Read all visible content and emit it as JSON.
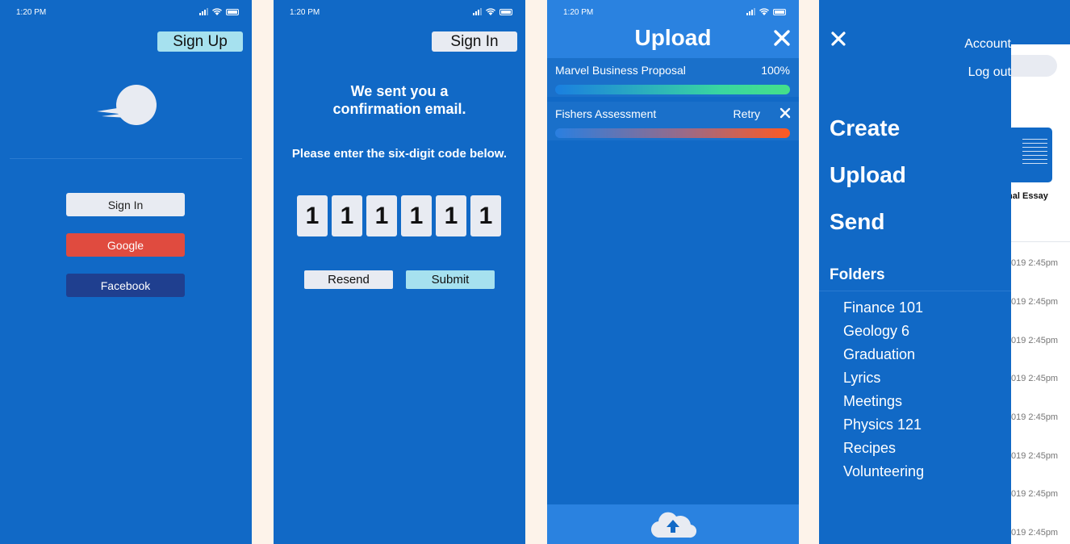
{
  "screen1": {
    "time": "1:20 PM",
    "signup_label": "Sign Up",
    "signin_label": "Sign In",
    "google_label": "Google",
    "facebook_label": "Facebook"
  },
  "screen2": {
    "time": "1:20 PM",
    "signin_label": "Sign In",
    "title_line1": "We sent you a",
    "title_line2": "confirmation email.",
    "subtitle": "Please enter the six-digit code below.",
    "code": [
      "1",
      "1",
      "1",
      "1",
      "1",
      "1"
    ],
    "resend_label": "Resend",
    "submit_label": "Submit"
  },
  "screen3": {
    "time": "1:20 PM",
    "title": "Upload",
    "uploads": [
      {
        "name": "Marvel Business Proposal",
        "status": "100%",
        "progress": 1.0,
        "state": "complete"
      },
      {
        "name": "Fishers Assessment",
        "status": "Retry",
        "state": "failed"
      }
    ]
  },
  "screen4": {
    "account_label": "Account",
    "logout_label": "Log out",
    "menu": [
      "Create",
      "Upload",
      "Send"
    ],
    "folders_heading": "Folders",
    "folders": [
      "Finance 101",
      "Geology 6",
      "Graduation",
      "Lyrics",
      "Meetings",
      "Physics 121",
      "Recipes",
      "Volunteering"
    ],
    "background_doc_label": "inal Essay",
    "background_timestamps": [
      "019 2:45pm",
      "019 2:45pm",
      "019 2:45pm",
      "019 2:45pm",
      "019 2:45pm",
      "019 2:45pm",
      "019 2:45pm",
      "019 2:45pm"
    ]
  },
  "colors": {
    "primary_blue": "#1169c6",
    "accent_cyan": "#a6e1ef",
    "google_red": "#e04b3f",
    "facebook_navy": "#1f3f8f",
    "page_background": "#fdf3ea"
  }
}
